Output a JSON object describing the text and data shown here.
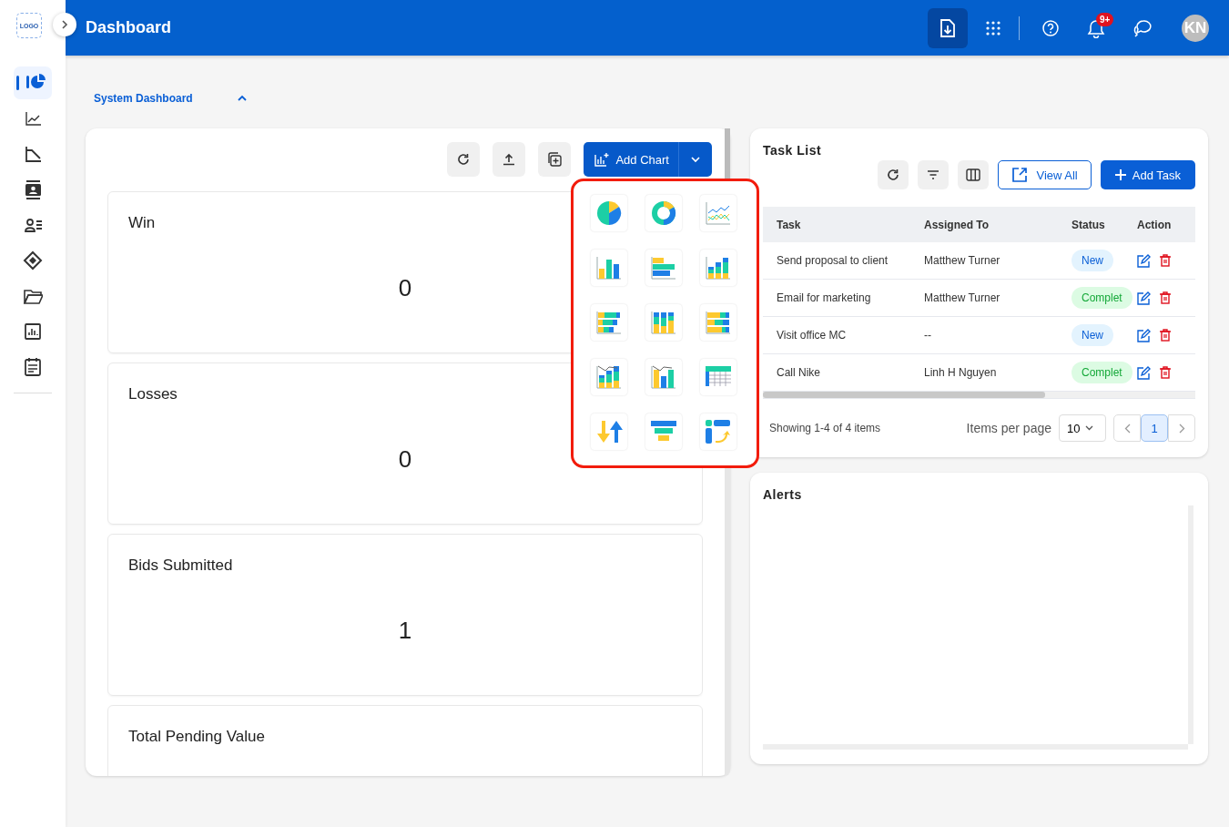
{
  "header": {
    "title": "Dashboard",
    "notification_badge": "9+",
    "avatar": "KN"
  },
  "sidebar": {
    "logo": "LOGO",
    "items": [
      {
        "selected": true
      },
      {
        "selected": false
      },
      {
        "selected": false
      },
      {
        "selected": false
      },
      {
        "selected": false
      },
      {
        "selected": false
      },
      {
        "selected": false
      },
      {
        "selected": false
      },
      {
        "selected": false
      }
    ]
  },
  "section": {
    "title": "System Dashboard",
    "expanded": true
  },
  "dashboard_panel": {
    "add_chart_label": "Add Chart",
    "chart_menu_open": true,
    "cards": [
      {
        "title": "Win",
        "value": "0"
      },
      {
        "title": "Losses",
        "value": "0"
      },
      {
        "title": "Bids Submitted",
        "value": "1"
      },
      {
        "title": "Total Pending Value"
      }
    ]
  },
  "task_list": {
    "title": "Task List",
    "view_all": "View All",
    "add_task": "Add Task",
    "columns": [
      "Task",
      "Assigned To",
      "Status",
      "Action"
    ],
    "rows": [
      {
        "task": "Send proposal to client",
        "assigned_to": "Matthew Turner",
        "status": {
          "label": "New",
          "kind": "new"
        }
      },
      {
        "task": "Email for marketing",
        "assigned_to": "Matthew Turner",
        "status": {
          "label": "Complet",
          "kind": "completed"
        }
      },
      {
        "task": "Visit office MC",
        "assigned_to": "--",
        "status": {
          "label": "New",
          "kind": "new"
        }
      },
      {
        "task": "Call Nike",
        "assigned_to": "Linh H Nguyen",
        "status": {
          "label": "Complet",
          "kind": "completed"
        }
      }
    ],
    "summary": "Showing 1-4 of 4 items",
    "items_per_page_label": "Items per page",
    "items_per_page": "10",
    "pages": [
      {
        "label": "1",
        "selected": true
      }
    ]
  },
  "alerts": {
    "title": "Alerts"
  }
}
